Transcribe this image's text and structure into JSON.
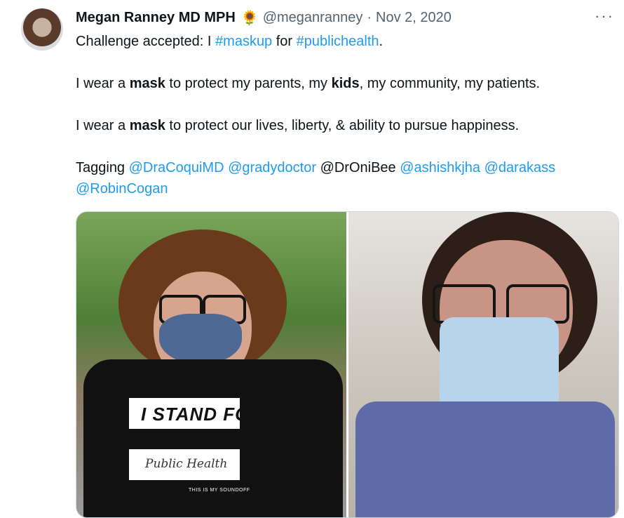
{
  "tweet": {
    "author": {
      "name": "Megan Ranney MD MPH",
      "emoji": "🌻",
      "handle": "@meganranney",
      "separator": "·",
      "date": "Nov 2, 2020"
    },
    "more_label": "···",
    "body": {
      "l1": {
        "a": "Challenge accepted: I ",
        "tag1": "#maskup",
        "b": " for ",
        "tag2": "#publichealth",
        "c": "."
      },
      "l2": {
        "a": "I wear a ",
        "b1": "mask",
        "c": " to protect my parents, my ",
        "b2": "kids",
        "d": ", my community, my patients."
      },
      "l3": {
        "a": "I wear a ",
        "b1": "mask",
        "c": " to protect our lives, liberty, & ability to pursue happiness."
      },
      "l4": {
        "a": "Tagging ",
        "m1": "@DraCoquiMD",
        "m2": "@gradydoctor",
        "m3": "@DrOniBee",
        "m4": "@ashishkjha",
        "m5": "@darakass",
        "m6": "@RobinCogan"
      }
    },
    "media": {
      "shirt_line1": "I STAND FOR",
      "shirt_line2": "Public Health",
      "shirt_small": "THIS IS MY SOUNDOFF"
    }
  }
}
